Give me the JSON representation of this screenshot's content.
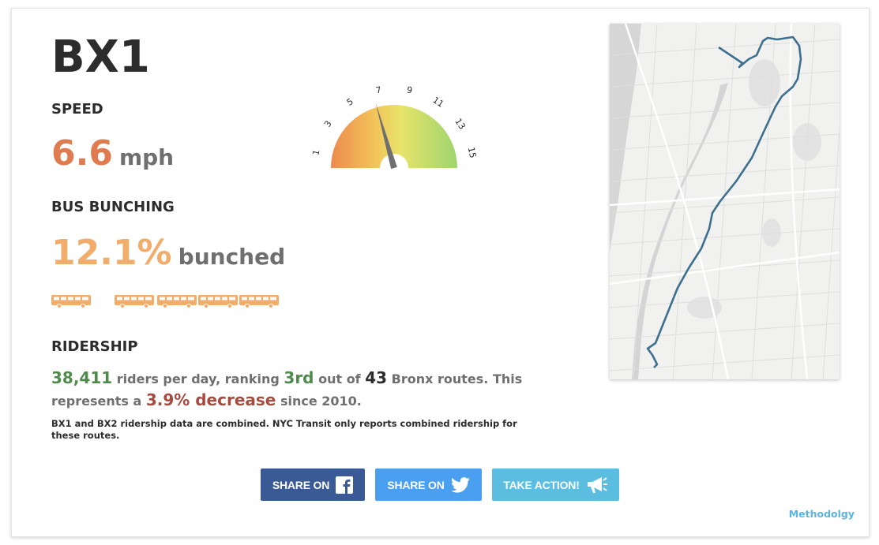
{
  "route": {
    "name": "BX1"
  },
  "speed": {
    "label": "SPEED",
    "value": "6.6",
    "unit": "mph",
    "value_color": "#e07b4f"
  },
  "gauge": {
    "ticks": [
      "1",
      "3",
      "5",
      "7",
      "9",
      "11",
      "13",
      "15"
    ],
    "min": 0,
    "max": 16,
    "value": 6.6
  },
  "bunching": {
    "label": "BUS BUNCHING",
    "value": "12.1%",
    "unit": "bunched",
    "value_color": "#f2ad6b",
    "bus_icons": [
      "bus-icon",
      "bus-icon",
      "bus-icon",
      "bus-icon",
      "bus-icon"
    ],
    "bus_color": "#f2ad6b"
  },
  "ridership": {
    "label": "RIDERSHIP",
    "riders": "38,411",
    "t1": " riders per day, ranking ",
    "rank": "3rd",
    "t2": " out of ",
    "total": "43",
    "t3": " Bronx routes. This represents a ",
    "change": "3.9% decrease",
    "t4": " since 2010.",
    "note": "BX1 and BX2 ridership data are combined. NYC Transit only reports combined ridership for these routes."
  },
  "buttons": {
    "share_facebook": "SHARE ON",
    "share_twitter": "SHARE ON",
    "take_action": "TAKE ACTION!"
  },
  "footer": {
    "methodology": "Methodolgy"
  },
  "colors": {
    "facebook": "#3a5a96",
    "twitter": "#4a9ff0",
    "action": "#5bbde0",
    "route_line": "#3d6f8e"
  }
}
